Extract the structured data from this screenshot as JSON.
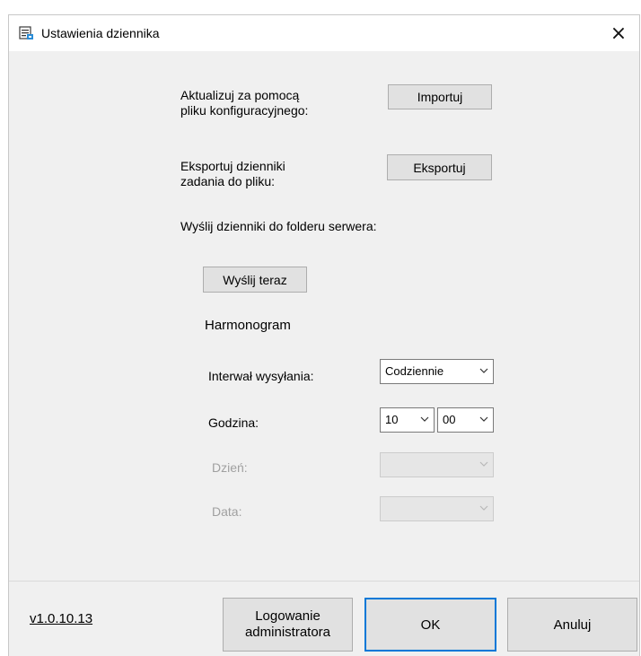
{
  "window": {
    "title": "Ustawienia dziennika",
    "close_symbol": "×"
  },
  "import_section": {
    "label_line1": "Aktualizuj za pomocą",
    "label_line2": "pliku konfiguracyjnego:",
    "button_label": "Importuj"
  },
  "export_section": {
    "label_line1": "Eksportuj dzienniki",
    "label_line2": "zadania do pliku:",
    "button_label": "Eksportuj"
  },
  "send_section": {
    "label": "Wyślij dzienniki do folderu serwera:",
    "button_label": "Wyślij teraz"
  },
  "schedule": {
    "heading": "Harmonogram",
    "interval_label": "Interwał wysyłania:",
    "interval_value": "Codziennie",
    "hour_label": "Godzina:",
    "hour_value": "10",
    "minute_value": "00",
    "day_label": "Dzień:",
    "day_value": "",
    "date_label": "Data:",
    "date_value": ""
  },
  "footer": {
    "version": "v1.0.10.13",
    "admin_line1": "Logowanie",
    "admin_line2": "administratora",
    "ok_label": "OK",
    "cancel_label": "Anuluj"
  },
  "icons": {
    "window_icon": "log-settings-icon",
    "dropdown_arrow": "chevron-down-icon"
  },
  "colors": {
    "accent": "#0078d7",
    "dialog_bg": "#f0f0f0",
    "disabled_text": "#a0a0a0"
  }
}
